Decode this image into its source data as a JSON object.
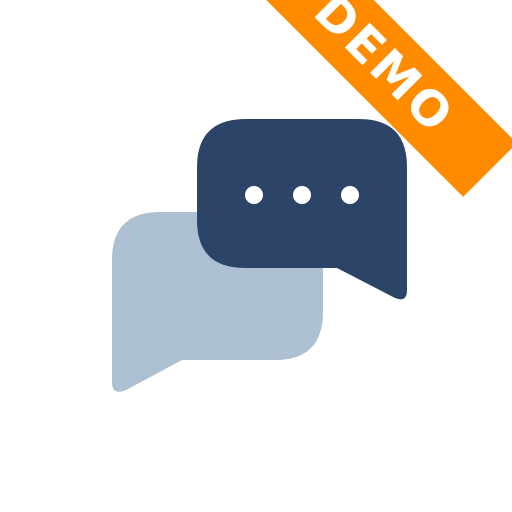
{
  "icon": {
    "name": "chat-app-icon",
    "background_color": "#ffffff",
    "back_bubble_color": "#adc0d1",
    "front_bubble_color": "#2b4468",
    "dot_color": "#ffffff",
    "typing_indicator_dots": 3
  },
  "ribbon": {
    "label": "DEMO",
    "color": "#ff8c00",
    "text_color": "#ffffff",
    "placement": "top-right"
  }
}
